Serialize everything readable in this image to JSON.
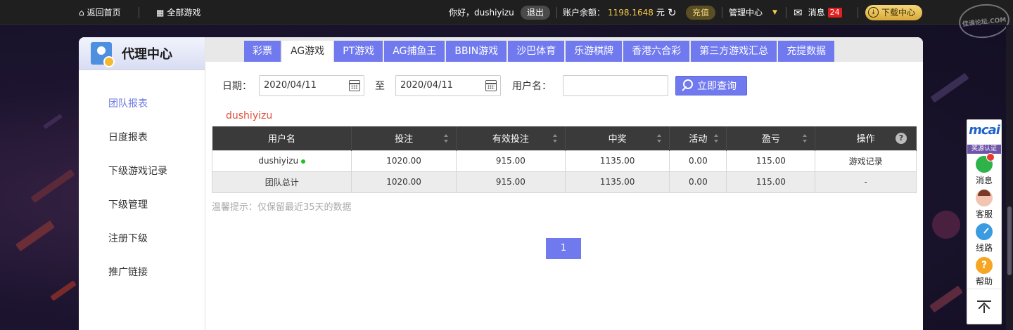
{
  "topbar": {
    "home_label": "返回首页",
    "all_games_label": "全部游戏",
    "greeting": "你好，dushiyizu",
    "logout_label": "退出",
    "balance_label": "账户余额：",
    "balance_value": "1198.1648",
    "balance_unit": "元",
    "recharge_label": "充值",
    "manage_label": "管理中心",
    "messages_label": "消息",
    "messages_count": "24",
    "download_label": "下载中心",
    "watermark_text": "佳谁论坛.COM"
  },
  "sidebar": {
    "title": "代理中心",
    "items": [
      {
        "label": "团队报表",
        "active": true
      },
      {
        "label": "日度报表"
      },
      {
        "label": "下级游戏记录"
      },
      {
        "label": "下级管理"
      },
      {
        "label": "注册下级"
      },
      {
        "label": "推广链接"
      }
    ]
  },
  "tabs": [
    {
      "label": "彩票"
    },
    {
      "label": "AG游戏",
      "active": true
    },
    {
      "label": "PT游戏"
    },
    {
      "label": "AG捕鱼王"
    },
    {
      "label": "BBIN游戏"
    },
    {
      "label": "沙巴体育"
    },
    {
      "label": "乐游棋牌"
    },
    {
      "label": "香港六合彩"
    },
    {
      "label": "第三方游戏汇总"
    },
    {
      "label": "充提数据"
    }
  ],
  "filter": {
    "date_label": "日期：",
    "start_date": "2020/04/11",
    "to_label": "至",
    "end_date": "2020/04/11",
    "username_label": "用户名：",
    "username_value": "",
    "query_label": "立即查询"
  },
  "current_user": "dushiyizu",
  "table": {
    "headers": [
      "用户名",
      "投注",
      "有效投注",
      "中奖",
      "活动",
      "盈亏",
      "操作"
    ],
    "rows": [
      {
        "user": "dushiyizu",
        "bet": "1020.00",
        "valid_bet": "915.00",
        "win": "1135.00",
        "activity": "0.00",
        "profit": "115.00",
        "action": "游戏记录"
      }
    ],
    "total": {
      "label": "团队总计",
      "bet": "1020.00",
      "valid_bet": "915.00",
      "win": "1135.00",
      "activity": "0.00",
      "profit": "115.00",
      "action": "-"
    }
  },
  "hint": "温馨提示：仅保留最近35天的数据",
  "pagination": {
    "current_page": "1"
  },
  "rail": {
    "brand": "mcai",
    "cert_label": "奖源认证",
    "items": [
      {
        "label": "消息",
        "icon": "message-icon"
      },
      {
        "label": "客服",
        "icon": "customer-service-icon"
      },
      {
        "label": "线路",
        "icon": "route-icon"
      },
      {
        "label": "帮助",
        "icon": "help-icon"
      }
    ]
  },
  "colors": {
    "accent": "#7179ee",
    "gold": "#f2c94c",
    "alert": "#e04e3c"
  }
}
